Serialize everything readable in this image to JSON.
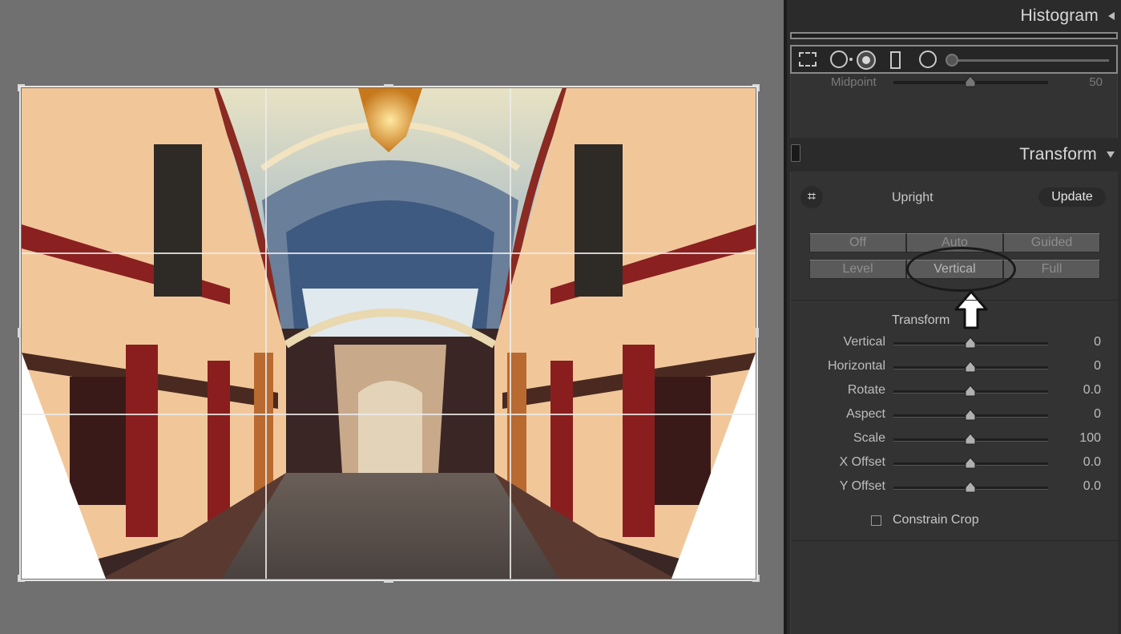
{
  "histogram": {
    "title": "Histogram"
  },
  "previous_panel": {
    "midpoint_label": "Midpoint",
    "midpoint_value": "50"
  },
  "transform": {
    "title": "Transform",
    "upright_label": "Upright",
    "update_label": "Update",
    "upright_modes": [
      "Off",
      "Auto",
      "Guided",
      "Level",
      "Vertical",
      "Full"
    ],
    "sub_title": "Transform",
    "sliders": [
      {
        "label": "Vertical",
        "value": "0"
      },
      {
        "label": "Horizontal",
        "value": "0"
      },
      {
        "label": "Rotate",
        "value": "0.0"
      },
      {
        "label": "Aspect",
        "value": "0"
      },
      {
        "label": "Scale",
        "value": "100"
      },
      {
        "label": "X Offset",
        "value": "0.0"
      },
      {
        "label": "Y Offset",
        "value": "0.0"
      }
    ],
    "constrain_crop_label": "Constrain Crop",
    "constrain_crop_checked": false
  },
  "icons": {
    "crop": "crop-icon",
    "panel_collapse": "triangle-left-icon",
    "panel_expand": "triangle-down-icon"
  },
  "colors": {
    "panel_bg": "#2b2b2b",
    "canvas_bg": "#707070",
    "annotation": "#1a1a1a"
  }
}
